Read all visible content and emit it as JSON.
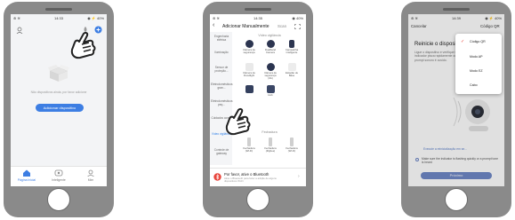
{
  "phone1": {
    "status_left": "⊛ ≋",
    "status_time": "14:33",
    "status_right": "◉ ⚡ 40%",
    "empty_text": "Não dispositivos ainda, por favor adicione",
    "add_button": "Adicionar dispositivo",
    "tabs": [
      {
        "label": "Página Inicial",
        "icon": "home-icon"
      },
      {
        "label": "Inteligente",
        "icon": "smart-icon"
      },
      {
        "label": "Mim",
        "icon": "profile-icon"
      }
    ],
    "accent": "#3d7ee3"
  },
  "phone2": {
    "status_left": "⊛ ≋",
    "status_time": "14:35",
    "status_right": "◉ 40%",
    "back": "‹",
    "title": "Adicionar Manualmente",
    "scan": "Scan",
    "sidebar": [
      "Engenharia elétrica",
      "Iluminação",
      "Sensor de proteção...",
      "Eletrodomésticos gran...",
      "Eletrodomésticos peq...",
      "Cuidados com...",
      "Vídeo vigilância",
      "Controle de gateway"
    ],
    "section_video": "Vídeo vigilância",
    "devices": [
      "Câmera de segurança",
      "Dualband Camera",
      "Campainha inteligente",
      "Câmera de Floodlight",
      "Câmera de segurança (4G)",
      "Estação de Base",
      "",
      "Hub"
    ],
    "section_fechadura": "Fechadura",
    "locks": [
      "Fechadura (Wi-Fi)",
      "Fechadura (Zigbee)",
      "Fechadura (Wi-Fi)"
    ],
    "bt_title": "Por favor, ative o Bluetooth",
    "bt_sub": "Ative o Bluetooth para fazer a adição de alguns dispositivos Wi-Fi",
    "accent": "#2c7ee8"
  },
  "phone3": {
    "status_left": "⊛ ≋",
    "status_time": "14:39",
    "status_right": "◉ ⚡ 40%",
    "cancel": "Cancelar",
    "mode": "Código QR",
    "heading": "Reinicie o dispositivo",
    "body": "Ligue o dispositivo e verifique se o indicador pisca rapidamente ou um prompt sonoro é ouvido.",
    "reset_link": "Execute a reinicialização em se...",
    "check_text": "Make sure the indicator is flashing quickly or a prompt tone is heard",
    "next_button": "Próximo",
    "menu": [
      "Código QR",
      "Modo AP",
      "Modo EZ",
      "Cabo"
    ],
    "menu_selected": "Código QR"
  }
}
